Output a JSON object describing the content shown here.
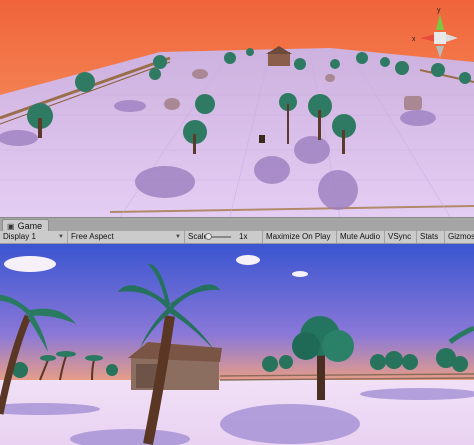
{
  "tab": {
    "title": "Game"
  },
  "toolbar": {
    "display": "Display 1",
    "aspect": "Free Aspect",
    "scale_label": "Scale",
    "scale_value": "1x",
    "maximize": "Maximize On Play",
    "mute": "Mute Audio",
    "vsync": "VSync",
    "stats": "Stats",
    "gizmos": "Gizmos"
  },
  "gizmo": {
    "x_label": "x",
    "y_label": "y"
  },
  "icons": [
    "game-icon",
    "dropdown-caret-icon",
    "scene-axis-gizmo-icon"
  ],
  "colors": {
    "sky_top": "#f46a3a",
    "sky_bottom": "#f59a6a",
    "ground": "#d7c0ee",
    "game_sky": "#3f5bd0",
    "toolbar": "#cbcbcb"
  }
}
